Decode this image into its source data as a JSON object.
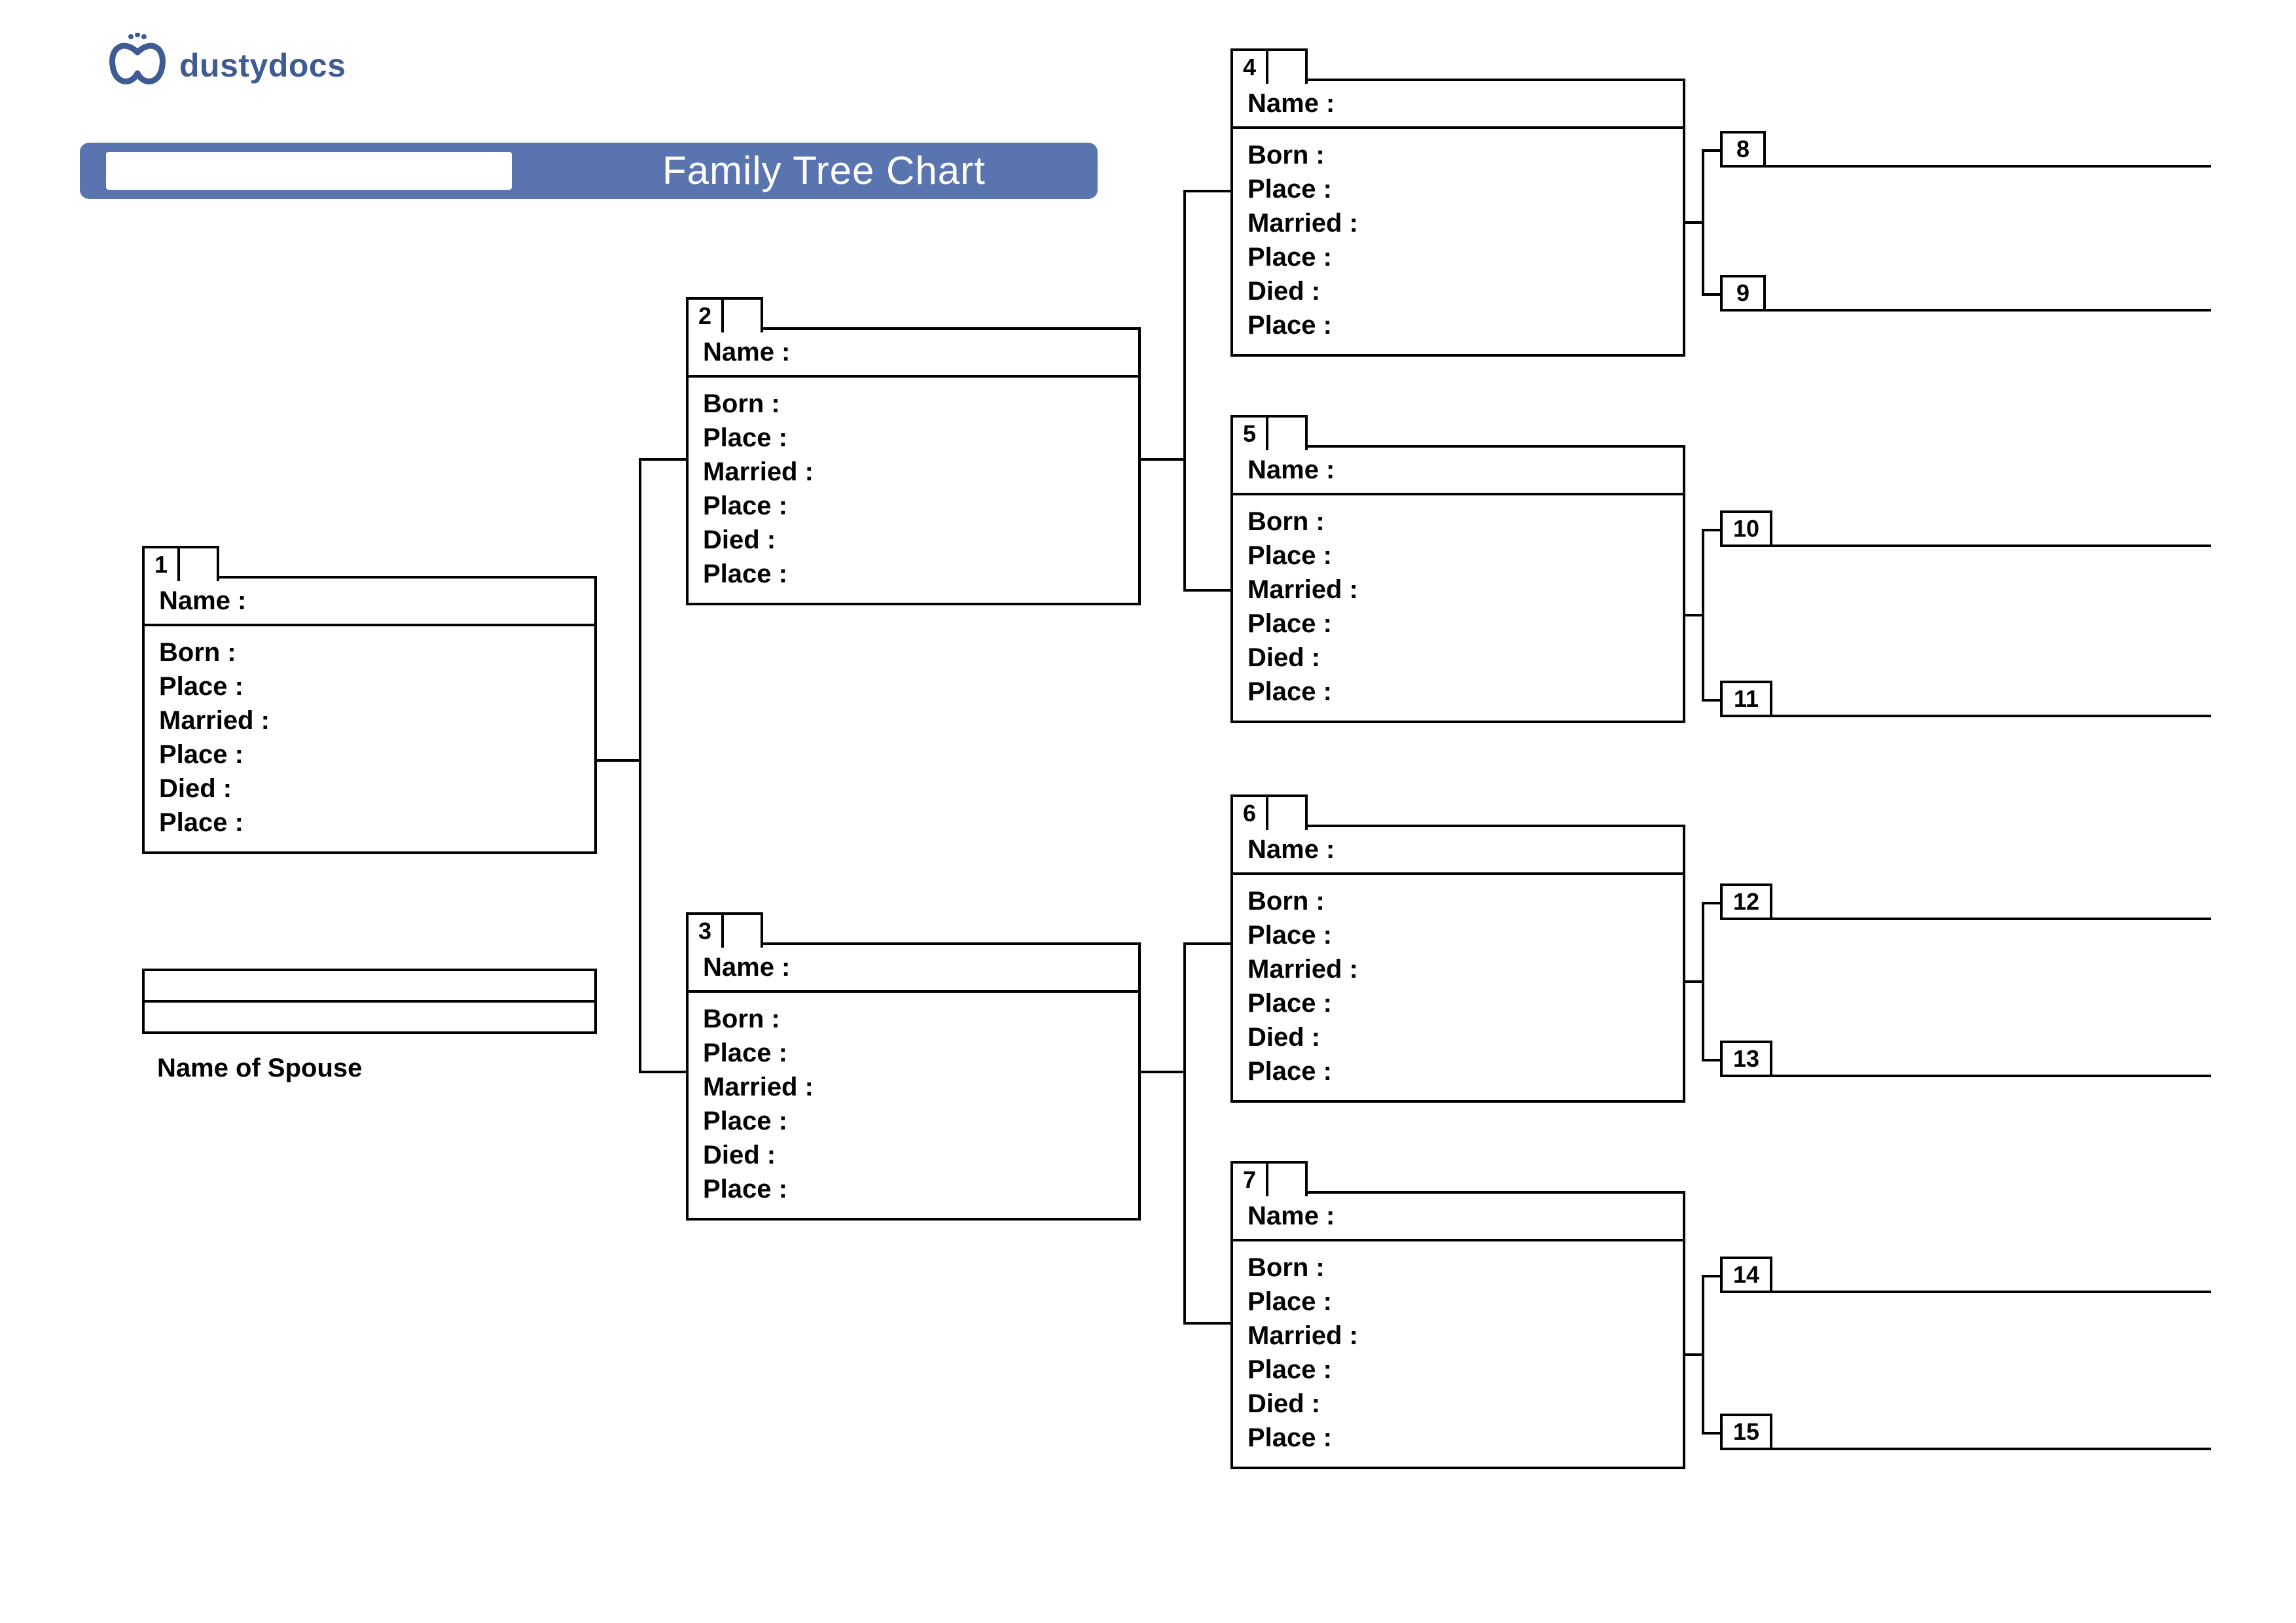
{
  "brand": {
    "name": "dustydocs"
  },
  "title": "Family Tree Chart",
  "labels": {
    "name": "Name :",
    "born": "Born :",
    "place": "Place :",
    "married": "Married :",
    "died": "Died :",
    "spouse": "Name of Spouse"
  },
  "people": {
    "p1": {
      "num": "1"
    },
    "p2": {
      "num": "2"
    },
    "p3": {
      "num": "3"
    },
    "p4": {
      "num": "4"
    },
    "p5": {
      "num": "5"
    },
    "p6": {
      "num": "6"
    },
    "p7": {
      "num": "7"
    },
    "p8": {
      "num": "8"
    },
    "p9": {
      "num": "9"
    },
    "p10": {
      "num": "10"
    },
    "p11": {
      "num": "11"
    },
    "p12": {
      "num": "12"
    },
    "p13": {
      "num": "13"
    },
    "p14": {
      "num": "14"
    },
    "p15": {
      "num": "15"
    }
  }
}
